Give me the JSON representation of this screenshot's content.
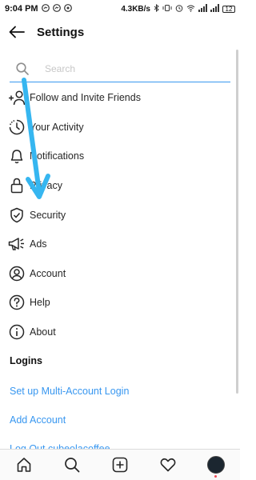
{
  "status_bar": {
    "time": "9:04 PM",
    "speed": "4.3KB/s",
    "battery": "12",
    "icons": [
      "messenger-icon",
      "messenger-icon",
      "whatsapp-icon",
      "bluetooth-icon",
      "vibrate-icon",
      "alarm-icon",
      "wifi-icon",
      "signal-icon",
      "signal-icon",
      "battery-icon"
    ]
  },
  "header": {
    "title": "Settings"
  },
  "search": {
    "placeholder": "Search",
    "value": ""
  },
  "items": [
    {
      "label": "Follow and Invite Friends",
      "icon": "add-person-icon"
    },
    {
      "label": "Your Activity",
      "icon": "activity-clock-icon"
    },
    {
      "label": "Notifications",
      "icon": "bell-icon"
    },
    {
      "label": "Privacy",
      "icon": "lock-icon"
    },
    {
      "label": "Security",
      "icon": "shield-check-icon"
    },
    {
      "label": "Ads",
      "icon": "megaphone-icon"
    },
    {
      "label": "Account",
      "icon": "account-circle-icon"
    },
    {
      "label": "Help",
      "icon": "help-icon"
    },
    {
      "label": "About",
      "icon": "info-icon"
    }
  ],
  "logins": {
    "title": "Logins",
    "links": [
      "Set up Multi-Account Login",
      "Add Account",
      "Log Out cubeolacoffee"
    ]
  },
  "colors": {
    "link": "#3897f0",
    "overlay_arrow": "#36b6f0",
    "text": "#262626"
  },
  "bottom_nav": [
    "home-icon",
    "search-icon",
    "add-post-icon",
    "heart-icon",
    "profile-avatar"
  ]
}
